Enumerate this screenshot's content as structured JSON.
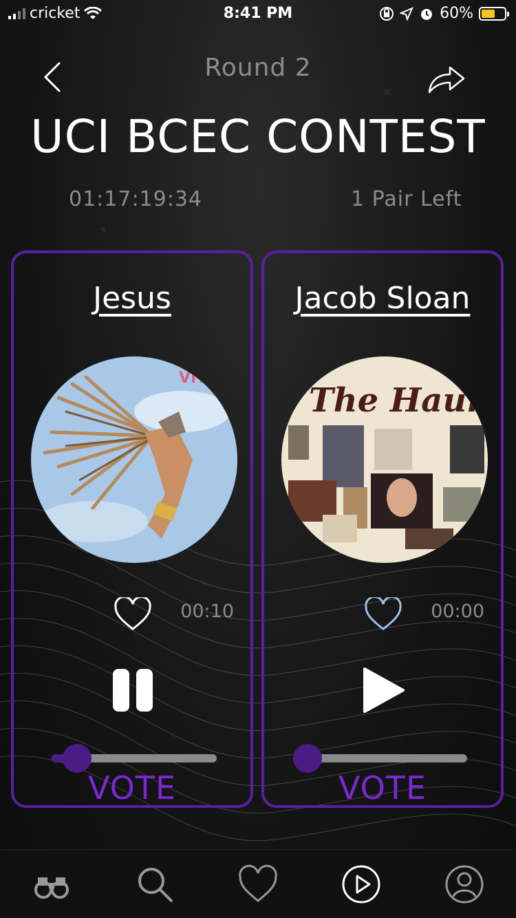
{
  "status_bar": {
    "carrier": "cricket",
    "time": "8:41 PM",
    "battery": "60%",
    "battery_level": 0.6
  },
  "header": {
    "round": "Round 2",
    "title": "UCI BCEC CONTEST",
    "countdown": "01:17:19:34",
    "pairs_left": "1 Pair Left"
  },
  "contestants": [
    {
      "name": "Jesus",
      "cover_icon": "album-cover-feathered-dancer",
      "cover_text": "VIV",
      "time": "00:10",
      "playback_state": "playing",
      "progress": 0.12,
      "vote_label": "VOTE"
    },
    {
      "name": "Jacob Sloan",
      "cover_icon": "album-cover-the-haunts",
      "cover_text": "The Haunts",
      "time": "00:00",
      "playback_state": "paused",
      "progress": 0.0,
      "vote_label": "VOTE"
    }
  ],
  "tabbar": {
    "items": [
      "binoculars-icon",
      "search-icon",
      "heart-icon",
      "play-circle-icon",
      "profile-icon"
    ],
    "active": "play-circle-icon"
  },
  "colors": {
    "accent": "#5a1fa0",
    "vote": "#7a28d6",
    "muted_text": "#8c8c8c",
    "battery": "#f5c518"
  }
}
